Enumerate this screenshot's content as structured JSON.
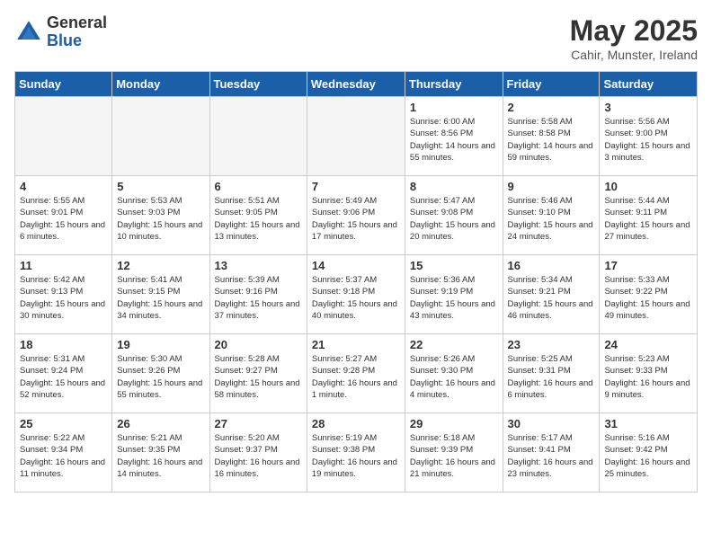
{
  "logo": {
    "general": "General",
    "blue": "Blue",
    "icon_title": "GeneralBlue logo"
  },
  "header": {
    "month": "May 2025",
    "location": "Cahir, Munster, Ireland"
  },
  "weekdays": [
    "Sunday",
    "Monday",
    "Tuesday",
    "Wednesday",
    "Thursday",
    "Friday",
    "Saturday"
  ],
  "weeks": [
    [
      {
        "day": "",
        "info": ""
      },
      {
        "day": "",
        "info": ""
      },
      {
        "day": "",
        "info": ""
      },
      {
        "day": "",
        "info": ""
      },
      {
        "day": "1",
        "info": "Sunrise: 6:00 AM\nSunset: 8:56 PM\nDaylight: 14 hours and 55 minutes."
      },
      {
        "day": "2",
        "info": "Sunrise: 5:58 AM\nSunset: 8:58 PM\nDaylight: 14 hours and 59 minutes."
      },
      {
        "day": "3",
        "info": "Sunrise: 5:56 AM\nSunset: 9:00 PM\nDaylight: 15 hours and 3 minutes."
      }
    ],
    [
      {
        "day": "4",
        "info": "Sunrise: 5:55 AM\nSunset: 9:01 PM\nDaylight: 15 hours and 6 minutes."
      },
      {
        "day": "5",
        "info": "Sunrise: 5:53 AM\nSunset: 9:03 PM\nDaylight: 15 hours and 10 minutes."
      },
      {
        "day": "6",
        "info": "Sunrise: 5:51 AM\nSunset: 9:05 PM\nDaylight: 15 hours and 13 minutes."
      },
      {
        "day": "7",
        "info": "Sunrise: 5:49 AM\nSunset: 9:06 PM\nDaylight: 15 hours and 17 minutes."
      },
      {
        "day": "8",
        "info": "Sunrise: 5:47 AM\nSunset: 9:08 PM\nDaylight: 15 hours and 20 minutes."
      },
      {
        "day": "9",
        "info": "Sunrise: 5:46 AM\nSunset: 9:10 PM\nDaylight: 15 hours and 24 minutes."
      },
      {
        "day": "10",
        "info": "Sunrise: 5:44 AM\nSunset: 9:11 PM\nDaylight: 15 hours and 27 minutes."
      }
    ],
    [
      {
        "day": "11",
        "info": "Sunrise: 5:42 AM\nSunset: 9:13 PM\nDaylight: 15 hours and 30 minutes."
      },
      {
        "day": "12",
        "info": "Sunrise: 5:41 AM\nSunset: 9:15 PM\nDaylight: 15 hours and 34 minutes."
      },
      {
        "day": "13",
        "info": "Sunrise: 5:39 AM\nSunset: 9:16 PM\nDaylight: 15 hours and 37 minutes."
      },
      {
        "day": "14",
        "info": "Sunrise: 5:37 AM\nSunset: 9:18 PM\nDaylight: 15 hours and 40 minutes."
      },
      {
        "day": "15",
        "info": "Sunrise: 5:36 AM\nSunset: 9:19 PM\nDaylight: 15 hours and 43 minutes."
      },
      {
        "day": "16",
        "info": "Sunrise: 5:34 AM\nSunset: 9:21 PM\nDaylight: 15 hours and 46 minutes."
      },
      {
        "day": "17",
        "info": "Sunrise: 5:33 AM\nSunset: 9:22 PM\nDaylight: 15 hours and 49 minutes."
      }
    ],
    [
      {
        "day": "18",
        "info": "Sunrise: 5:31 AM\nSunset: 9:24 PM\nDaylight: 15 hours and 52 minutes."
      },
      {
        "day": "19",
        "info": "Sunrise: 5:30 AM\nSunset: 9:26 PM\nDaylight: 15 hours and 55 minutes."
      },
      {
        "day": "20",
        "info": "Sunrise: 5:28 AM\nSunset: 9:27 PM\nDaylight: 15 hours and 58 minutes."
      },
      {
        "day": "21",
        "info": "Sunrise: 5:27 AM\nSunset: 9:28 PM\nDaylight: 16 hours and 1 minute."
      },
      {
        "day": "22",
        "info": "Sunrise: 5:26 AM\nSunset: 9:30 PM\nDaylight: 16 hours and 4 minutes."
      },
      {
        "day": "23",
        "info": "Sunrise: 5:25 AM\nSunset: 9:31 PM\nDaylight: 16 hours and 6 minutes."
      },
      {
        "day": "24",
        "info": "Sunrise: 5:23 AM\nSunset: 9:33 PM\nDaylight: 16 hours and 9 minutes."
      }
    ],
    [
      {
        "day": "25",
        "info": "Sunrise: 5:22 AM\nSunset: 9:34 PM\nDaylight: 16 hours and 11 minutes."
      },
      {
        "day": "26",
        "info": "Sunrise: 5:21 AM\nSunset: 9:35 PM\nDaylight: 16 hours and 14 minutes."
      },
      {
        "day": "27",
        "info": "Sunrise: 5:20 AM\nSunset: 9:37 PM\nDaylight: 16 hours and 16 minutes."
      },
      {
        "day": "28",
        "info": "Sunrise: 5:19 AM\nSunset: 9:38 PM\nDaylight: 16 hours and 19 minutes."
      },
      {
        "day": "29",
        "info": "Sunrise: 5:18 AM\nSunset: 9:39 PM\nDaylight: 16 hours and 21 minutes."
      },
      {
        "day": "30",
        "info": "Sunrise: 5:17 AM\nSunset: 9:41 PM\nDaylight: 16 hours and 23 minutes."
      },
      {
        "day": "31",
        "info": "Sunrise: 5:16 AM\nSunset: 9:42 PM\nDaylight: 16 hours and 25 minutes."
      }
    ]
  ]
}
